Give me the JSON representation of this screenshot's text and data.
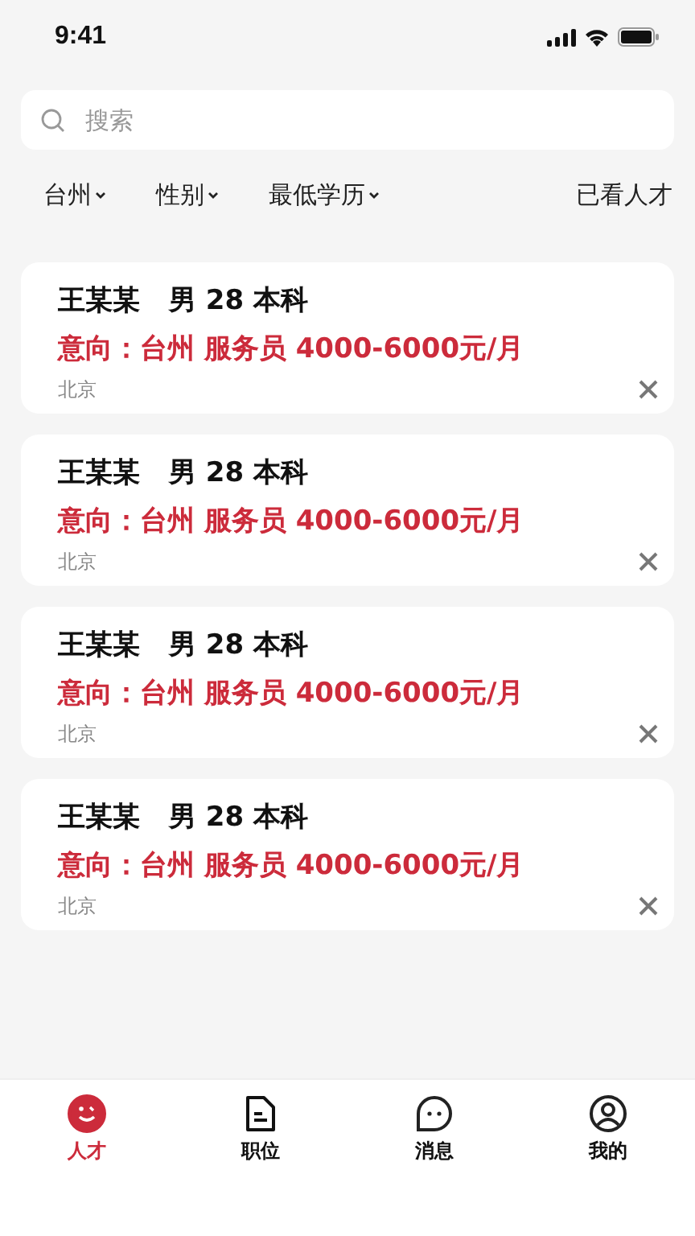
{
  "status_bar": {
    "time": "9:41"
  },
  "search": {
    "placeholder": "搜索"
  },
  "filters": [
    {
      "label": "台州"
    },
    {
      "label": "性别"
    },
    {
      "label": "最低学历"
    }
  ],
  "viewed_link": "已看人才",
  "candidates": [
    {
      "name": "王某某",
      "info": "男 28 本科",
      "intent": "意向：台州 服务员 4000-6000元/月",
      "location": "北京"
    },
    {
      "name": "王某某",
      "info": "男 28 本科",
      "intent": "意向：台州 服务员 4000-6000元/月",
      "location": "北京"
    },
    {
      "name": "王某某",
      "info": "男 28 本科",
      "intent": "意向：台州 服务员 4000-6000元/月",
      "location": "北京"
    },
    {
      "name": "王某某",
      "info": "男 28 本科",
      "intent": "意向：台州 服务员 4000-6000元/月",
      "location": "北京"
    }
  ],
  "tab_bar": [
    {
      "kind": "talent",
      "label": "人才",
      "selected": true
    },
    {
      "kind": "jobs",
      "label": "职位",
      "selected": false
    },
    {
      "kind": "messages",
      "label": "消息",
      "selected": false
    },
    {
      "kind": "profile",
      "label": "我的",
      "selected": false
    }
  ]
}
